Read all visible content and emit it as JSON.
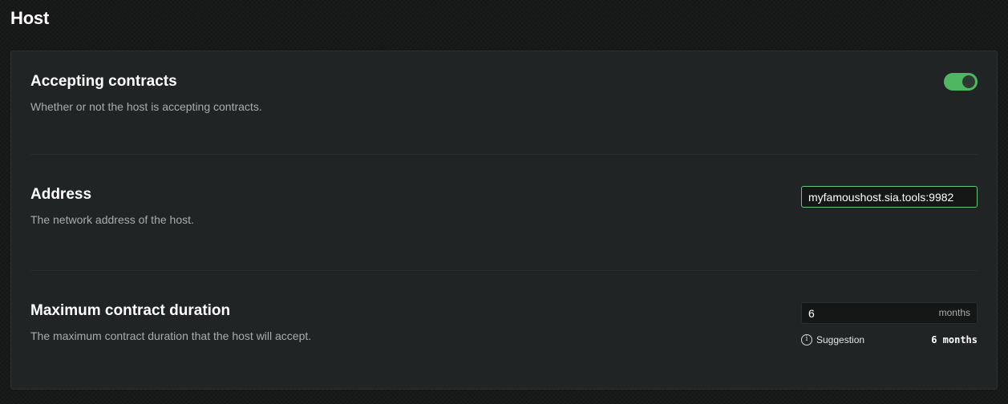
{
  "page": {
    "title": "Host"
  },
  "settings": {
    "accepting_contracts": {
      "title": "Accepting contracts",
      "description": "Whether or not the host is accepting contracts.",
      "enabled": true,
      "toggle_color": "#4fb662"
    },
    "address": {
      "title": "Address",
      "description": "The network address of the host.",
      "value": "myfamoushost.sia.tools:9982"
    },
    "max_contract_duration": {
      "title": "Maximum contract duration",
      "description": "The maximum contract duration that the host will accept.",
      "value": "6",
      "unit": "months",
      "suggestion_label": "Suggestion",
      "suggestion_value": "6 months",
      "info_icon": "info-icon"
    }
  }
}
